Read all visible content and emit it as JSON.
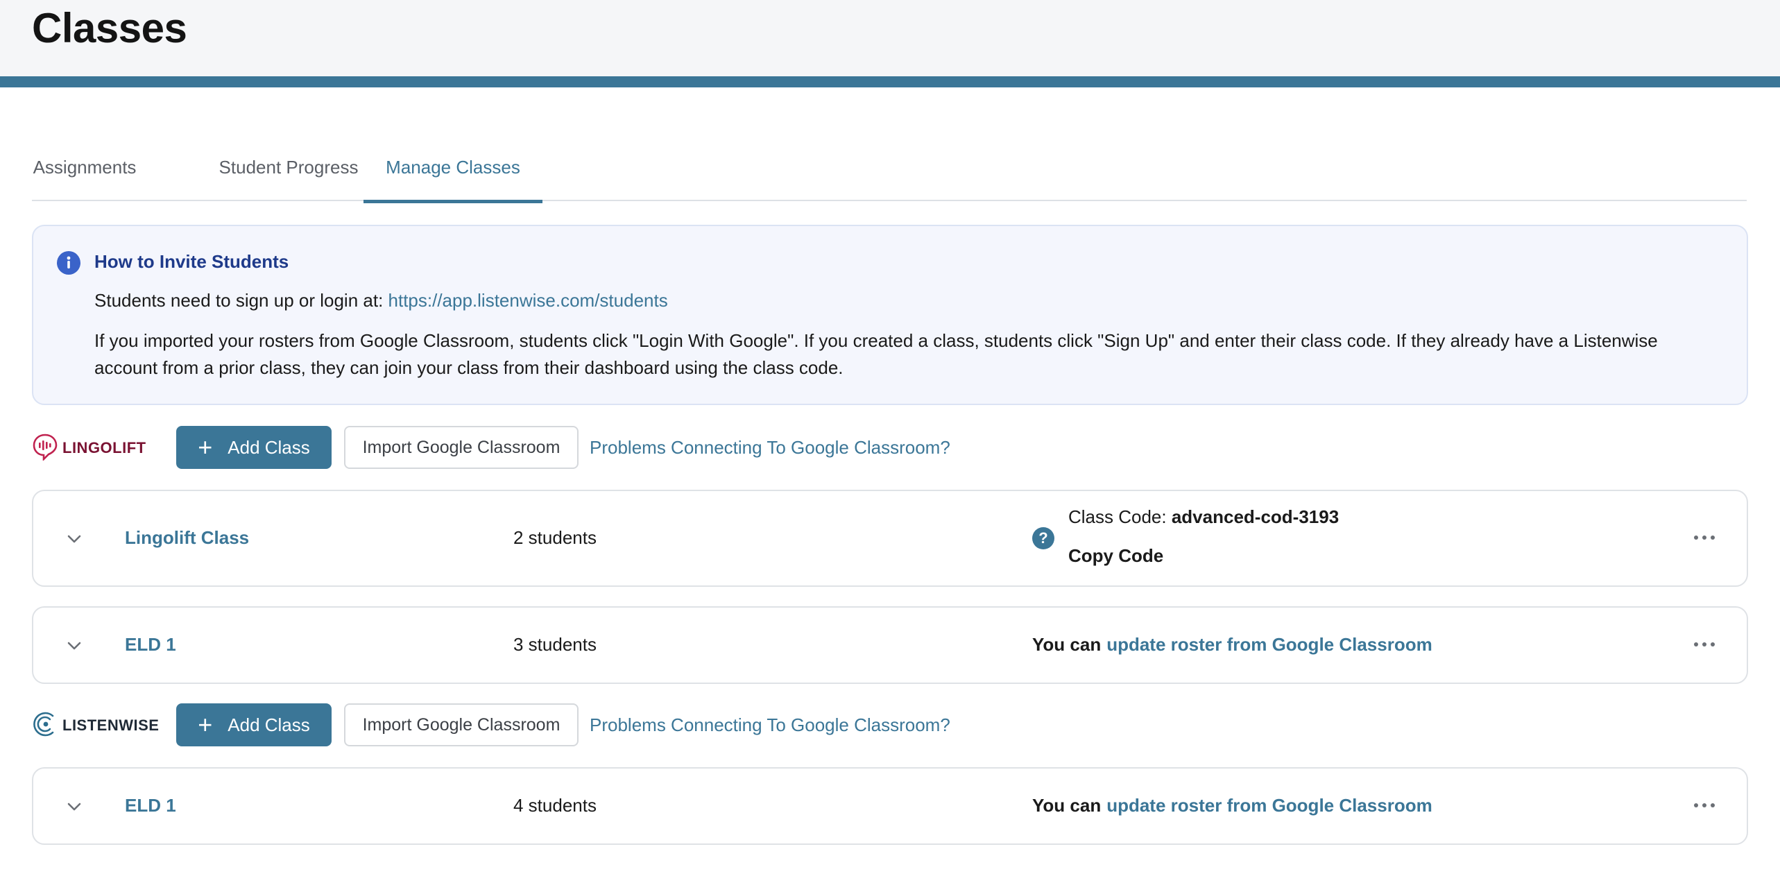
{
  "page": {
    "title": "Classes"
  },
  "tabs": [
    {
      "label": "Assignments",
      "active": false
    },
    {
      "label": "Student Progress",
      "active": false
    },
    {
      "label": "Manage Classes",
      "active": true
    }
  ],
  "info": {
    "title": "How to Invite Students",
    "line1_prefix": "Students need to sign up or login at: ",
    "line1_link": "https://app.listenwise.com/students",
    "line2": "If you imported your rosters from Google Classroom, students click \"Login With Google\". If you created a class, students click \"Sign Up\" and enter their class code. If they already have a Listenwise account from a prior class, they can join your class from their dashboard using the class code."
  },
  "sections": [
    {
      "brand": "LINGOLIFT",
      "brand_icon": "lingolift-logo",
      "brand_color": "#7a1232",
      "add_label": "Add Class",
      "import_label": "Import Google Classroom",
      "problems_label": "Problems Connecting To Google Classroom?",
      "classes": [
        {
          "name": "Lingolift Class",
          "students": "2 students",
          "code_label": "Class Code: ",
          "code": "advanced-cod-3193",
          "copy_label": "Copy Code"
        },
        {
          "name": "ELD 1",
          "students": "3 students",
          "roster_prefix": "You can",
          "roster_link": "update roster from Google Classroom"
        }
      ]
    },
    {
      "brand": "LISTENWISE",
      "brand_icon": "listenwise-logo",
      "brand_color": "#1f2a36",
      "add_label": "Add Class",
      "import_label": "Import Google Classroom",
      "problems_label": "Problems Connecting To Google Classroom?",
      "classes": [
        {
          "name": "ELD 1",
          "students": "4 students",
          "roster_prefix": "You can",
          "roster_link": "update roster from Google Classroom"
        }
      ]
    }
  ],
  "colors": {
    "accent": "#3b7697",
    "info_title": "#1e3a8a",
    "info_bg": "#f4f6fd",
    "lingolift": "#c0224f"
  }
}
